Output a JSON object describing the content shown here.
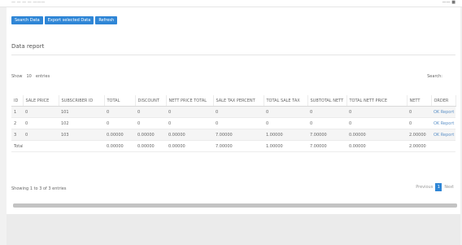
{
  "topbar": {
    "crumb_left": "—  —  —  — ———",
    "crumb_right": "——  ■"
  },
  "toolbar": {
    "buttons": [
      "Search Data",
      "Export selected Data",
      "Refresh"
    ]
  },
  "section": {
    "title": "Data report"
  },
  "controls": {
    "show_label": "Show",
    "show_value": "10",
    "entries_label": "entries",
    "search_label": "Search:"
  },
  "table": {
    "columns": [
      "ID",
      "SALE PRICE",
      "SUBSCRIBER ID",
      "TOTAL",
      "DISCOUNT",
      "NETT PRICE TOTAL",
      "SALE TAX PERCENT",
      "TOTAL SALE TAX",
      "SUBTOTAL NETT",
      "TOTAL NETT PRICE",
      "NETT",
      "ORDER"
    ],
    "rows": [
      [
        "1",
        "0",
        "101",
        "0",
        "0",
        "0",
        "0",
        "0",
        "0",
        "0",
        "0",
        "OK Report"
      ],
      [
        "2",
        "0",
        "102",
        "0",
        "0",
        "0",
        "0",
        "0",
        "0",
        "0",
        "0",
        "OK Report"
      ],
      [
        "3",
        "0",
        "103",
        "0.00000",
        "0.00000",
        "0.00000",
        "7.00000",
        "1.00000",
        "7.00000",
        "0.00000",
        "2.00000",
        "OK Report"
      ]
    ],
    "total_row": [
      "Total",
      "",
      "",
      "0.00000",
      "0.00000",
      "0.00000",
      "7.00000",
      "1.00000",
      "7.00000",
      "0.00000",
      "2.00000",
      ""
    ]
  },
  "footer": {
    "info": "Showing 1 to 3 of 3 entries",
    "prev": "Previous",
    "page": "1",
    "next": "Next"
  }
}
